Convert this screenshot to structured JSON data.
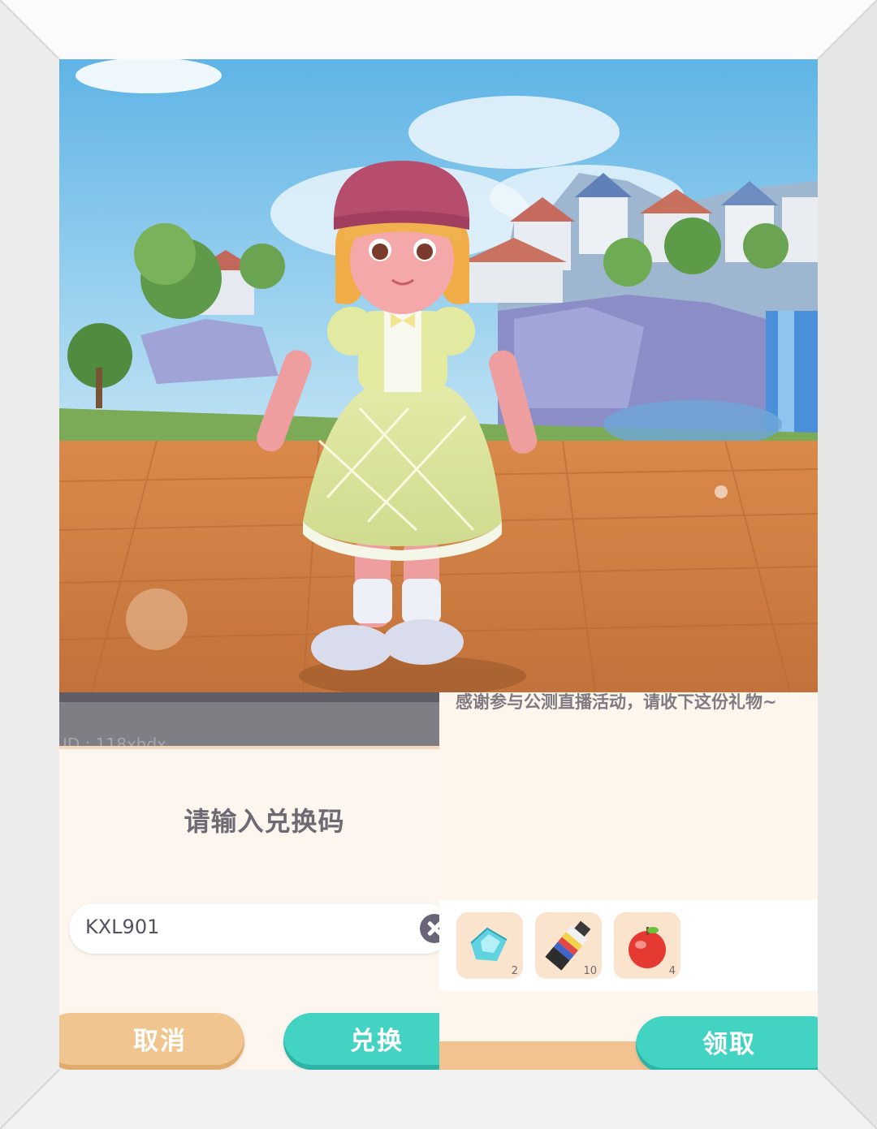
{
  "redeem_dialog": {
    "background_text": "ID : 118xhdx",
    "prompt": "请输入兑换码",
    "code_value": "KXL901",
    "cancel_label": "取消",
    "redeem_label": "兑换"
  },
  "mail": {
    "message": "感谢参与公测直播活动，请收下这份礼物~",
    "rewards": [
      {
        "icon": "crystal-icon",
        "qty": "2"
      },
      {
        "icon": "paint-tube-icon",
        "qty": "10"
      },
      {
        "icon": "apple-icon",
        "qty": "4"
      }
    ],
    "claim_label": "领取"
  },
  "colors": {
    "accent_teal": "#43d3c3",
    "accent_orange": "#f0c58f",
    "text_gray": "#6e6a74"
  }
}
